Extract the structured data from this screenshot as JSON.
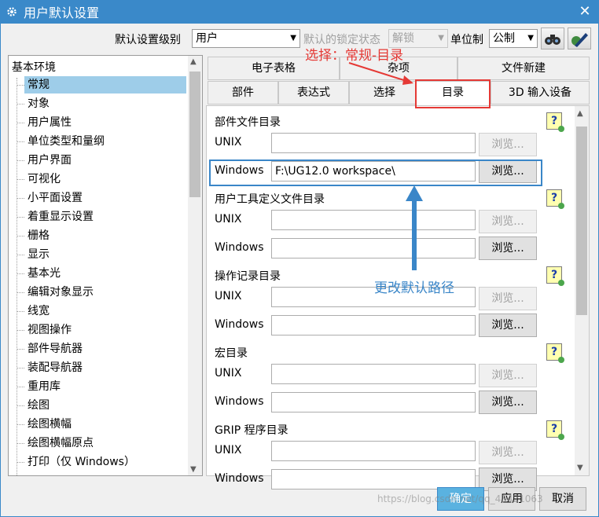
{
  "window": {
    "title": "用户默认设置",
    "close": "✕"
  },
  "toolbar": {
    "level_label": "默认设置级别",
    "level_value": "用户",
    "lock_label": "默认的锁定状态",
    "lock_value": "解锁",
    "unit_label": "单位制",
    "unit_value": "公制"
  },
  "tree": {
    "root": "基本环境",
    "items": [
      "常规",
      "对象",
      "用户属性",
      "单位类型和量纲",
      "用户界面",
      "可视化",
      "小平面设置",
      "着重显示设置",
      "栅格",
      "显示",
      "基本光",
      "编辑对象显示",
      "线宽",
      "视图操作",
      "部件导航器",
      "装配导航器",
      "重用库",
      "绘图",
      "绘图横幅",
      "绘图横幅原点",
      "打印（仅 Windows）"
    ],
    "selected": "常规"
  },
  "tabs": {
    "row1": [
      "电子表格",
      "杂项",
      "文件新建"
    ],
    "row2": [
      "部件",
      "表达式",
      "选择",
      "目录",
      "3D 输入设备"
    ],
    "active": "目录"
  },
  "sections": [
    {
      "title": "部件文件目录",
      "unix_label": "UNIX",
      "unix_value": "",
      "windows_label": "Windows",
      "windows_value": "F:\\UG12.0 workspace\\"
    },
    {
      "title": "用户工具定义文件目录",
      "unix_label": "UNIX",
      "unix_value": "",
      "windows_label": "Windows",
      "windows_value": ""
    },
    {
      "title": "操作记录目录",
      "unix_label": "UNIX",
      "unix_value": "",
      "windows_label": "Windows",
      "windows_value": ""
    },
    {
      "title": "宏目录",
      "unix_label": "UNIX",
      "unix_value": "",
      "windows_label": "Windows",
      "windows_value": ""
    },
    {
      "title": "GRIP 程序目录",
      "unix_label": "UNIX",
      "unix_value": "",
      "windows_label": "Windows",
      "windows_value": ""
    }
  ],
  "browse_label": "浏览...",
  "help_label": "?",
  "annotations": {
    "red_text": "选择：常规-目录",
    "blue_text": "更改默认路径"
  },
  "footer": {
    "ok": "确定",
    "apply": "应用",
    "cancel": "取消"
  },
  "watermark": "https://blog.csdn.net/qq_43421063",
  "colors": {
    "titlebar": "#3a89c9",
    "selection": "#9ecde9",
    "annotation_red": "#e53935",
    "annotation_blue": "#3a86c8"
  }
}
